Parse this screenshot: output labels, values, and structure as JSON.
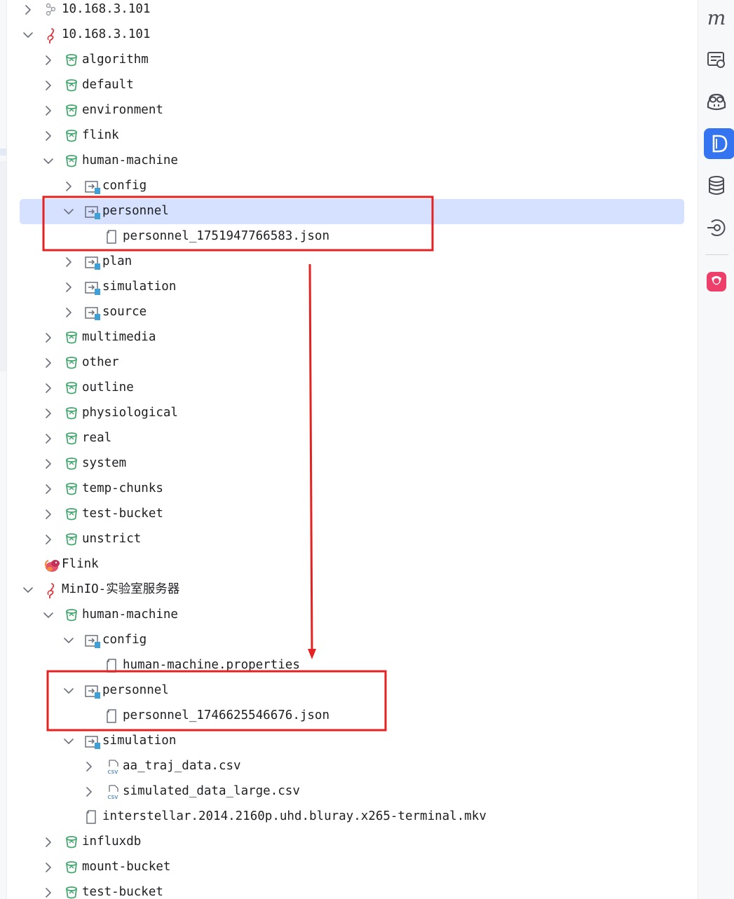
{
  "tree": [
    {
      "label": "10.168.3.101",
      "icon": "cluster-icon",
      "indent": 0,
      "expand": "collapsed"
    },
    {
      "label": "10.168.3.101",
      "icon": "minio-flamingo-icon",
      "indent": 0,
      "expand": "expanded"
    },
    {
      "label": "algorithm",
      "icon": "bucket-icon",
      "indent": 1,
      "expand": "collapsed"
    },
    {
      "label": "default",
      "icon": "bucket-icon",
      "indent": 1,
      "expand": "collapsed"
    },
    {
      "label": "environment",
      "icon": "bucket-icon",
      "indent": 1,
      "expand": "collapsed"
    },
    {
      "label": "flink",
      "icon": "bucket-icon",
      "indent": 1,
      "expand": "collapsed"
    },
    {
      "label": "human-machine",
      "icon": "bucket-icon",
      "indent": 1,
      "expand": "expanded"
    },
    {
      "label": "config",
      "icon": "folder-icon",
      "indent": 2,
      "expand": "collapsed"
    },
    {
      "label": "personnel",
      "icon": "folder-icon",
      "indent": 2,
      "expand": "expanded",
      "selected": true
    },
    {
      "label": "personnel_1751947766583.json",
      "icon": "file-icon",
      "indent": 3,
      "expand": "none"
    },
    {
      "label": "plan",
      "icon": "folder-icon",
      "indent": 2,
      "expand": "collapsed"
    },
    {
      "label": "simulation",
      "icon": "folder-icon",
      "indent": 2,
      "expand": "collapsed"
    },
    {
      "label": "source",
      "icon": "folder-icon",
      "indent": 2,
      "expand": "collapsed"
    },
    {
      "label": "multimedia",
      "icon": "bucket-icon",
      "indent": 1,
      "expand": "collapsed"
    },
    {
      "label": "other",
      "icon": "bucket-icon",
      "indent": 1,
      "expand": "collapsed"
    },
    {
      "label": "outline",
      "icon": "bucket-icon",
      "indent": 1,
      "expand": "collapsed"
    },
    {
      "label": "physiological",
      "icon": "bucket-icon",
      "indent": 1,
      "expand": "collapsed"
    },
    {
      "label": "real",
      "icon": "bucket-icon",
      "indent": 1,
      "expand": "collapsed"
    },
    {
      "label": "system",
      "icon": "bucket-icon",
      "indent": 1,
      "expand": "collapsed"
    },
    {
      "label": "temp-chunks",
      "icon": "bucket-icon",
      "indent": 1,
      "expand": "collapsed"
    },
    {
      "label": "test-bucket",
      "icon": "bucket-icon",
      "indent": 1,
      "expand": "collapsed"
    },
    {
      "label": "unstrict",
      "icon": "bucket-icon",
      "indent": 1,
      "expand": "collapsed"
    },
    {
      "label": "Flink",
      "icon": "flink-squirrel-icon",
      "indent": 0,
      "expand": "none"
    },
    {
      "label": "MinIO-实验室服务器",
      "icon": "minio-flamingo-icon",
      "indent": 0,
      "expand": "expanded"
    },
    {
      "label": "human-machine",
      "icon": "bucket-icon",
      "indent": 1,
      "expand": "expanded"
    },
    {
      "label": "config",
      "icon": "folder-icon",
      "indent": 2,
      "expand": "expanded"
    },
    {
      "label": "human-machine.properties",
      "icon": "file-icon",
      "indent": 3,
      "expand": "none"
    },
    {
      "label": "personnel",
      "icon": "folder-icon",
      "indent": 2,
      "expand": "expanded"
    },
    {
      "label": "personnel_1746625546676.json",
      "icon": "file-icon",
      "indent": 3,
      "expand": "none"
    },
    {
      "label": "simulation",
      "icon": "folder-icon",
      "indent": 2,
      "expand": "expanded"
    },
    {
      "label": "aa_traj_data.csv",
      "icon": "csv-file-icon",
      "indent": 3,
      "expand": "collapsed"
    },
    {
      "label": "simulated_data_large.csv",
      "icon": "csv-file-icon",
      "indent": 3,
      "expand": "collapsed"
    },
    {
      "label": "interstellar.2014.2160p.uhd.bluray.x265-terminal.mkv",
      "icon": "file-icon",
      "indent": 2,
      "expand": "none"
    },
    {
      "label": "influxdb",
      "icon": "bucket-icon",
      "indent": 1,
      "expand": "collapsed"
    },
    {
      "label": "mount-bucket",
      "icon": "bucket-icon",
      "indent": 1,
      "expand": "collapsed"
    },
    {
      "label": "test-bucket",
      "icon": "bucket-icon",
      "indent": 1,
      "expand": "collapsed"
    }
  ],
  "right_toolbar": {
    "items": [
      {
        "name": "maven-tool-button",
        "icon": "maven-m-icon"
      },
      {
        "name": "endpoints-tool-button",
        "icon": "endpoints-icon"
      },
      {
        "name": "copilot-tool-button",
        "icon": "copilot-icon"
      },
      {
        "name": "d-tool-button",
        "icon": "d-letter-icon",
        "active": true
      },
      {
        "name": "database-tool-button",
        "icon": "database-icon"
      },
      {
        "name": "services-tool-button",
        "icon": "services-icon"
      },
      {
        "name": "app-tool-button",
        "icon": "pink-app-icon"
      }
    ]
  },
  "colors": {
    "accent": "#3574f0",
    "selection": "#d5e1ff",
    "bucket_green": "#3fa66b",
    "annotation_red": "#e52222",
    "flamingo_red": "#d9363e"
  }
}
